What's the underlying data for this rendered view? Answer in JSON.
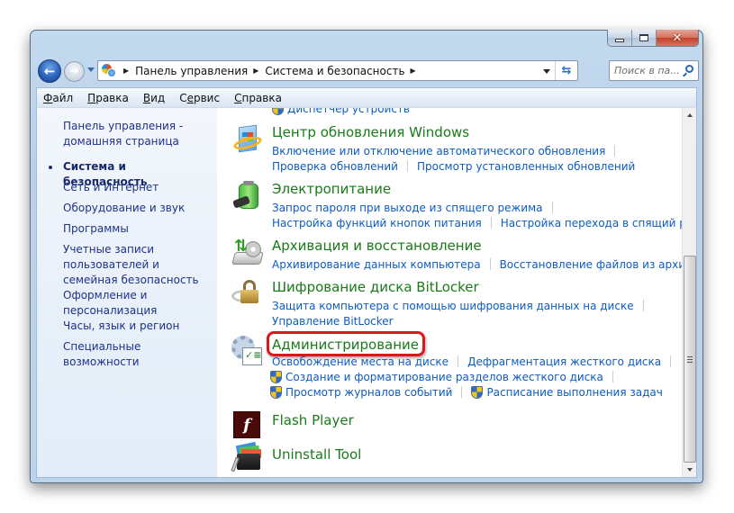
{
  "window": {
    "caption_buttons": {
      "minimize": "minimize",
      "maximize": "maximize",
      "close": "close"
    }
  },
  "nav": {
    "breadcrumbs": [
      "Панель управления",
      "Система и безопасность"
    ],
    "search_placeholder": "Поиск в па..."
  },
  "menu": [
    {
      "label": "Файл",
      "accel": "Ф",
      "rest": "айл"
    },
    {
      "label": "Правка",
      "accel": "П",
      "rest": "равка"
    },
    {
      "label": "Вид",
      "accel": "В",
      "rest": "ид"
    },
    {
      "label": "Сервис",
      "pre": "С",
      "accel": "е",
      "rest": "рвис"
    },
    {
      "label": "Справка",
      "accel": "С",
      "rest": "правка"
    }
  ],
  "sidebar": {
    "items": [
      {
        "label": "Панель управления - домашняя страница"
      },
      {
        "label": "Система и безопасность",
        "current": true
      },
      {
        "label": "Сеть и Интернет"
      },
      {
        "label": "Оборудование и звук"
      },
      {
        "label": "Программы"
      },
      {
        "label": "Учетные записи пользователей и семейная безопасность"
      },
      {
        "label": "Оформление и персонализация"
      },
      {
        "label": "Часы, язык и регион"
      },
      {
        "label": "Специальные возможности"
      }
    ]
  },
  "main": {
    "partial_top_link": "Диспетчер устройств",
    "categories": [
      {
        "title": "Центр обновления Windows",
        "icon": "windows-update-icon",
        "links": [
          [
            "Включение или отключение автоматического обновления"
          ],
          [
            "Проверка обновлений",
            "Просмотр установленных обновлений"
          ]
        ]
      },
      {
        "title": "Электропитание",
        "icon": "power-options-icon",
        "links": [
          [
            "Запрос пароля при выходе из спящего режима"
          ],
          [
            "Настройка функций кнопок питания",
            "Настройка перехода в спящий режим"
          ]
        ]
      },
      {
        "title": "Архивация и восстановление",
        "icon": "backup-restore-icon",
        "links": [
          [
            "Архивирование данных компьютера",
            "Восстановление файлов из архива"
          ]
        ]
      },
      {
        "title": "Шифрование диска BitLocker",
        "icon": "bitlocker-icon",
        "links": [
          [
            "Защита компьютера с помощью шифрования данных на диске"
          ],
          [
            "Управление BitLocker"
          ]
        ]
      },
      {
        "title": "Администрирование",
        "icon": "administrative-tools-icon",
        "highlighted": true,
        "links": [
          [
            "Освобождение места на диске",
            "Дефрагментация жесткого диска"
          ],
          [
            "Создание и форматирование разделов жесткого диска"
          ],
          [
            "Просмотр журналов событий",
            "Расписание выполнения задач"
          ]
        ]
      },
      {
        "title": "Flash Player",
        "icon": "flash-player-icon",
        "links": []
      },
      {
        "title": "Uninstall Tool",
        "icon": "uninstall-tool-icon",
        "links": []
      }
    ]
  },
  "colors": {
    "category_title": "#1a7a1a",
    "link": "#0d5cc0",
    "sidebar_link": "#1e3287",
    "highlight": "#e01515"
  }
}
